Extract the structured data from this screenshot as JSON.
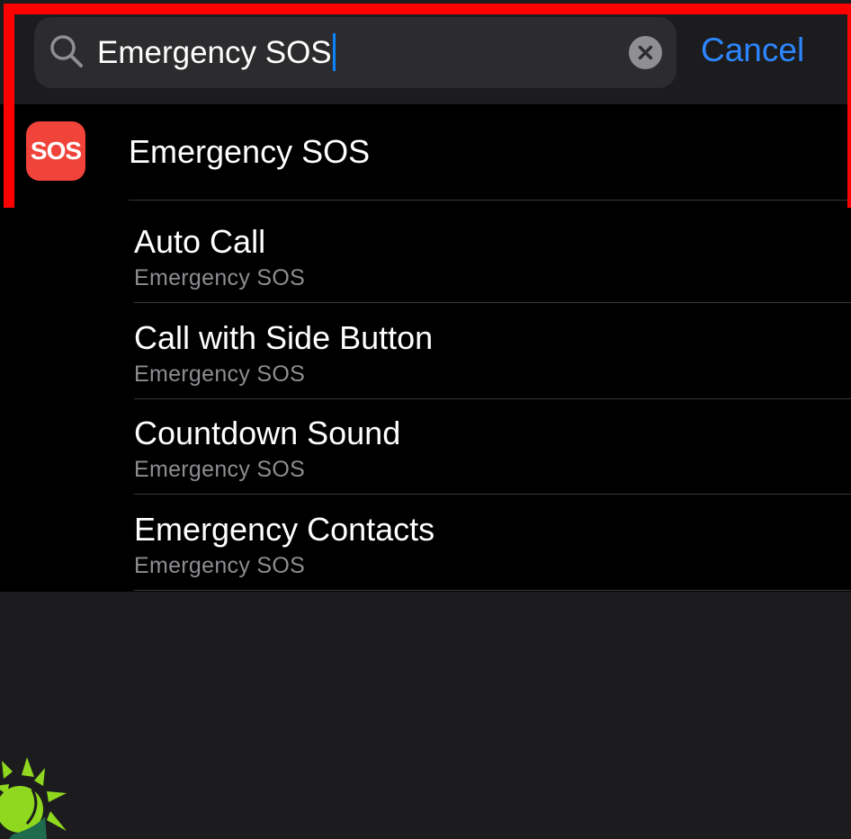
{
  "search": {
    "query": "Emergency SOS",
    "cancel_label": "Cancel"
  },
  "top_result": {
    "icon_text": "SOS",
    "label": "Emergency SOS"
  },
  "results": [
    {
      "title": "Auto Call",
      "subtitle": "Emergency SOS"
    },
    {
      "title": "Call with Side Button",
      "subtitle": "Emergency SOS"
    },
    {
      "title": "Countdown Sound",
      "subtitle": "Emergency SOS"
    },
    {
      "title": "Emergency Contacts",
      "subtitle": "Emergency SOS"
    }
  ],
  "colors": {
    "accent": "#2d86ff",
    "caret": "#0a84ff",
    "sos_icon_bg": "#f0433a",
    "highlight": "#ff0000",
    "background": "#1c1c1e"
  },
  "icons": {
    "search": "magnifying-glass",
    "clear": "x-circle-fill",
    "watermark": "green-sun-logo"
  }
}
